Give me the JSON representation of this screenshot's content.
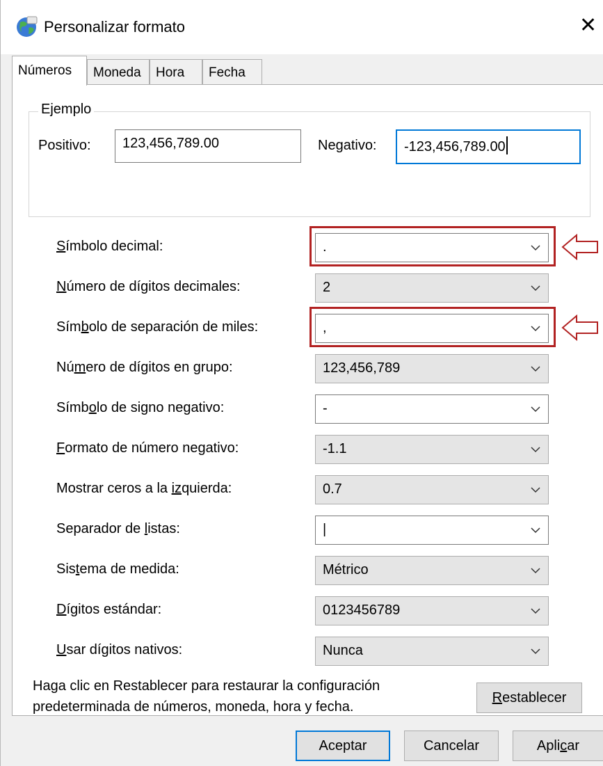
{
  "window": {
    "title": "Personalizar formato"
  },
  "tabs": [
    "Números",
    "Moneda",
    "Hora",
    "Fecha"
  ],
  "example": {
    "legend": "Ejemplo",
    "positive_label": "Positivo:",
    "positive_value": "123,456,789.00",
    "negative_label": "Negativo:",
    "negative_value": "-123,456,789.00"
  },
  "settings": [
    {
      "pre": "",
      "ul": "S",
      "post": "ímbolo decimal:",
      "value": "."
    },
    {
      "pre": "",
      "ul": "N",
      "post": "úmero de dígitos decimales:",
      "value": "2"
    },
    {
      "pre": "Sím",
      "ul": "b",
      "post": "olo de separación de miles:",
      "value": ","
    },
    {
      "pre": "Nú",
      "ul": "m",
      "post": "ero de dígitos en grupo:",
      "value": "123,456,789"
    },
    {
      "pre": "Símb",
      "ul": "o",
      "post": "lo de signo negativo:",
      "value": "-"
    },
    {
      "pre": "",
      "ul": "F",
      "post": "ormato de número negativo:",
      "value": "-1.1"
    },
    {
      "pre": "Mostrar ceros a la ",
      "ul": "iz",
      "post": "quierda:",
      "value": "0.7"
    },
    {
      "pre": "Separador de ",
      "ul": "l",
      "post": "istas:",
      "value": "|"
    },
    {
      "pre": "Sis",
      "ul": "t",
      "post": "ema de medida:",
      "value": "Métrico"
    },
    {
      "pre": "",
      "ul": "D",
      "post": "ígitos estándar:",
      "value": "0123456789"
    },
    {
      "pre": "",
      "ul": "U",
      "post": "sar dígitos nativos:",
      "value": "Nunca"
    }
  ],
  "reset": {
    "line1": "Haga clic en Restablecer para restaurar la configuración",
    "line2": "predeterminada de números, moneda, hora y fecha.",
    "button_ul": "R",
    "button_rest": "establecer"
  },
  "footer": {
    "accept": "Aceptar",
    "cancel": "Cancelar",
    "apply_pre": "Apli",
    "apply_ul": "c",
    "apply_post": "ar"
  },
  "colors": {
    "highlight": "#b22222",
    "focus": "#0078d7"
  }
}
